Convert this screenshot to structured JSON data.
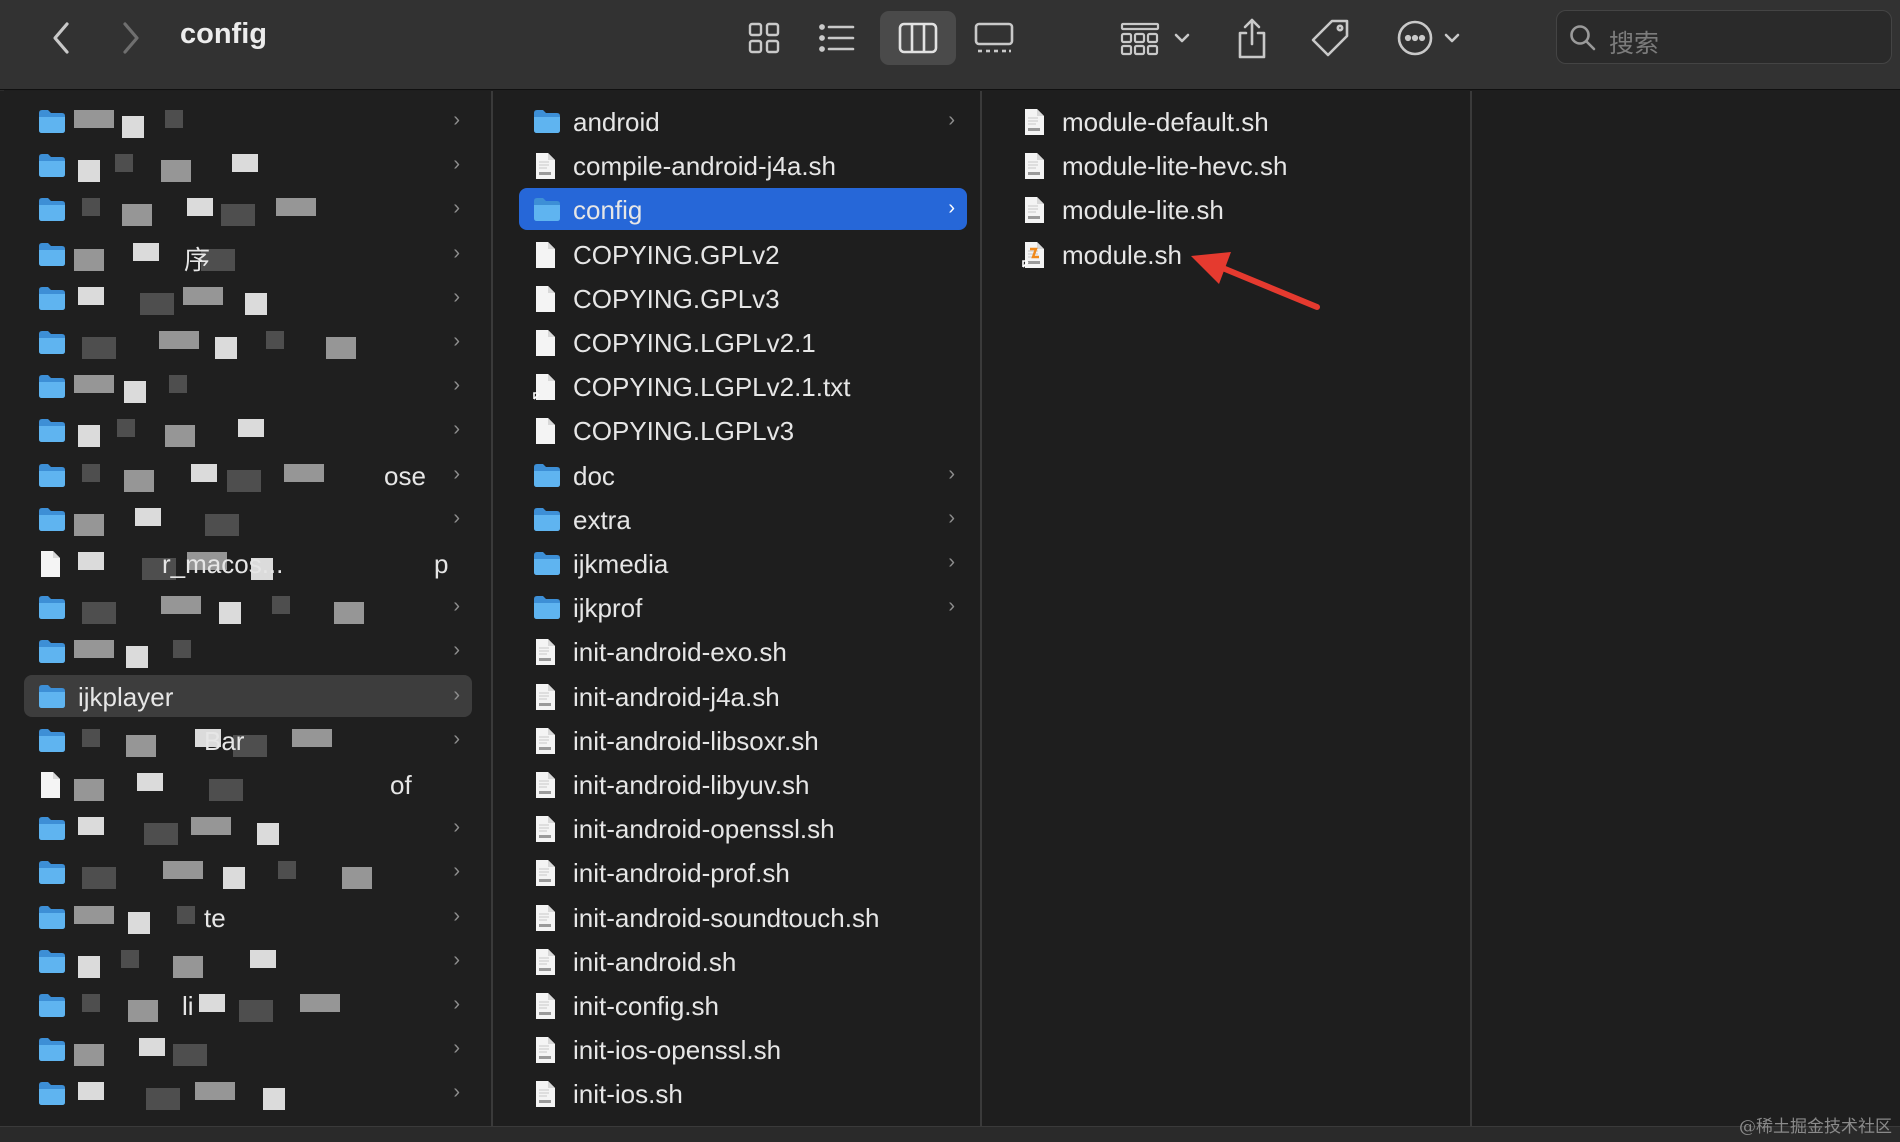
{
  "window": {
    "title": "config"
  },
  "search": {
    "placeholder": "搜索"
  },
  "colors": {
    "selection_blue": "#2667d8",
    "folder_blue": "#5fb4f0",
    "arrow_red": "#e53a2f"
  },
  "column2": {
    "items": [
      {
        "label": "android",
        "type": "folder",
        "chevron": true
      },
      {
        "label": "compile-android-j4a.sh",
        "type": "shell",
        "chevron": false
      },
      {
        "label": "config",
        "type": "folder",
        "chevron": true,
        "selected": true
      },
      {
        "label": "COPYING.GPLv2",
        "type": "doc",
        "chevron": false
      },
      {
        "label": "COPYING.GPLv3",
        "type": "doc",
        "chevron": false
      },
      {
        "label": "COPYING.LGPLv2.1",
        "type": "doc",
        "chevron": false
      },
      {
        "label": "COPYING.LGPLv2.1.txt",
        "type": "alias-doc",
        "chevron": false
      },
      {
        "label": "COPYING.LGPLv3",
        "type": "doc",
        "chevron": false
      },
      {
        "label": "doc",
        "type": "folder",
        "chevron": true
      },
      {
        "label": "extra",
        "type": "folder",
        "chevron": true
      },
      {
        "label": "ijkmedia",
        "type": "folder",
        "chevron": true
      },
      {
        "label": "ijkprof",
        "type": "folder",
        "chevron": true
      },
      {
        "label": "init-android-exo.sh",
        "type": "shell",
        "chevron": false
      },
      {
        "label": "init-android-j4a.sh",
        "type": "shell",
        "chevron": false
      },
      {
        "label": "init-android-libsoxr.sh",
        "type": "shell",
        "chevron": false
      },
      {
        "label": "init-android-libyuv.sh",
        "type": "shell",
        "chevron": false
      },
      {
        "label": "init-android-openssl.sh",
        "type": "shell",
        "chevron": false
      },
      {
        "label": "init-android-prof.sh",
        "type": "shell",
        "chevron": false
      },
      {
        "label": "init-android-soundtouch.sh",
        "type": "shell",
        "chevron": false
      },
      {
        "label": "init-android.sh",
        "type": "shell",
        "chevron": false
      },
      {
        "label": "init-config.sh",
        "type": "shell",
        "chevron": false
      },
      {
        "label": "init-ios-openssl.sh",
        "type": "shell",
        "chevron": false
      },
      {
        "label": "init-ios.sh",
        "type": "shell",
        "chevron": false
      }
    ]
  },
  "column3": {
    "items": [
      {
        "label": "module-default.sh",
        "type": "shell"
      },
      {
        "label": "module-lite-hevc.sh",
        "type": "shell"
      },
      {
        "label": "module-lite.sh",
        "type": "shell"
      },
      {
        "label": "module.sh",
        "type": "alias-shell"
      }
    ]
  },
  "column1": {
    "selected_label": "ijkplayer",
    "visible_fragments": [
      "序",
      "ose",
      "r_macos...",
      "p",
      "ijkplayer",
      "Bar",
      "of",
      "te",
      "li"
    ]
  },
  "watermark": "@稀土掘金技术社区",
  "icons": {
    "back": "chevron-left-icon",
    "forward": "chevron-right-icon",
    "icon_view": "grid-icon",
    "list_view": "list-icon",
    "column_view": "columns-icon",
    "gallery_view": "gallery-icon",
    "group": "group-icon",
    "share": "share-icon",
    "tag": "tag-icon",
    "more": "ellipsis-circle-icon",
    "search": "search-icon"
  }
}
